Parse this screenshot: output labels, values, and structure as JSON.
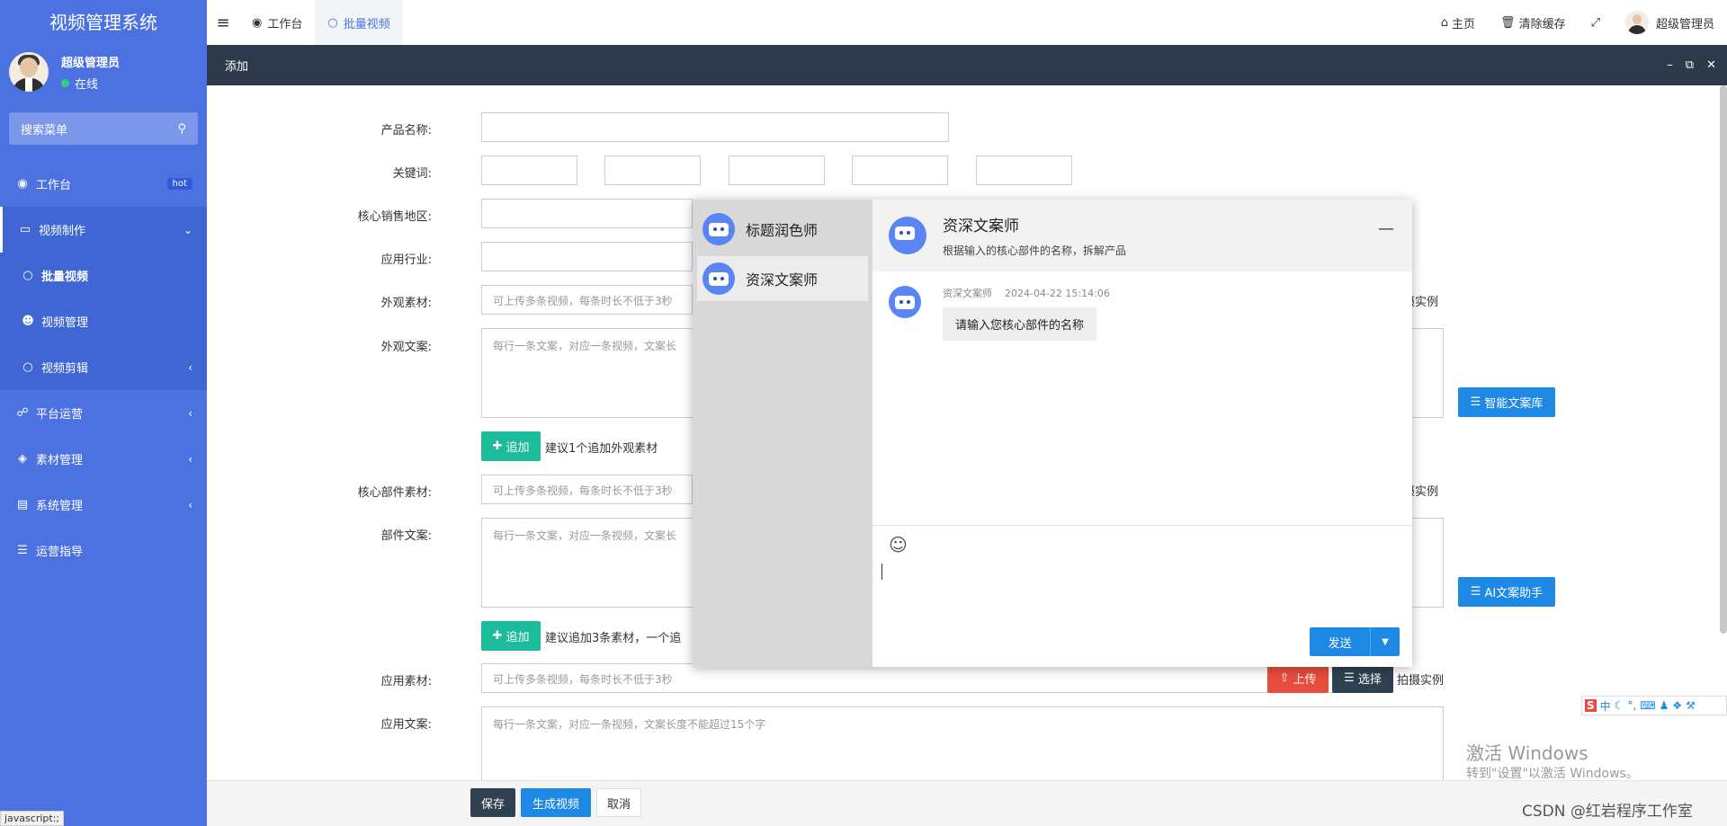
{
  "app_title": "视频管理系统",
  "user": {
    "name": "超级管理员",
    "status": "在线"
  },
  "search": {
    "placeholder": "搜索菜单"
  },
  "menu": {
    "workbench": {
      "label": "工作台",
      "badge": "hot"
    },
    "video_production": {
      "label": "视频制作"
    },
    "batch_video": {
      "label": "批量视频"
    },
    "video_management": {
      "label": "视频管理"
    },
    "video_editing": {
      "label": "视频剪辑"
    },
    "platform_ops": {
      "label": "平台运营"
    },
    "material_mgmt": {
      "label": "素材管理"
    },
    "system_mgmt": {
      "label": "系统管理"
    },
    "ops_guide": {
      "label": "运营指导"
    }
  },
  "status_url": "javascript:;",
  "topbar": {
    "tabs": [
      {
        "label": "工作台"
      },
      {
        "label": "批量视频"
      }
    ],
    "home": "主页",
    "clear_cache": "清除缓存",
    "user_name": "超级管理员"
  },
  "panel": {
    "title": "添加"
  },
  "form": {
    "product_name": "产品名称:",
    "keywords": "关键词:",
    "sales_region": "核心销售地区:",
    "industry": "应用行业:",
    "appearance_material": "外观素材:",
    "appearance_copy": "外观文案:",
    "core_part_material": "核心部件素材:",
    "part_copy": "部件文案:",
    "app_material": "应用素材:",
    "app_copy": "应用文案:",
    "upload_placeholder": "可上传多条视频，每条时长不低于3秒",
    "copy_placeholder": "每行一条文案，对应一条视频，文案长",
    "copy_placeholder_full": "每行一条文案，对应一条视频，文案长度不能超过15个字",
    "add_label": "追加",
    "hint_appearance": "建议1个追加外观素材",
    "hint_part": "建议追加3条素材，一个追",
    "shoot_example": "拍摄实例",
    "shoot_example_partial": "摄实例",
    "smart_library": "智能文案库",
    "ai_assistant": "AI文案助手",
    "upload": "上传",
    "select": "选择"
  },
  "footer": {
    "save": "保存",
    "generate": "生成视频",
    "cancel": "取消"
  },
  "chat": {
    "contacts": [
      {
        "name": "标题润色师"
      },
      {
        "name": "资深文案师"
      }
    ],
    "header": {
      "name": "资深文案师",
      "subtitle": "根据输入的核心部件的名称，拆解产品"
    },
    "message": {
      "sender": "资深文案师",
      "time": "2024-04-22 15:14:06",
      "text": "请输入您核心部件的名称"
    },
    "send_label": "发送"
  },
  "ime": {
    "s": "S",
    "lang": "中"
  },
  "watermark": {
    "line1": "激活 Windows",
    "line2": "转到\"设置\"以激活 Windows。"
  },
  "csdn": "CSDN @红岩程序工作室"
}
